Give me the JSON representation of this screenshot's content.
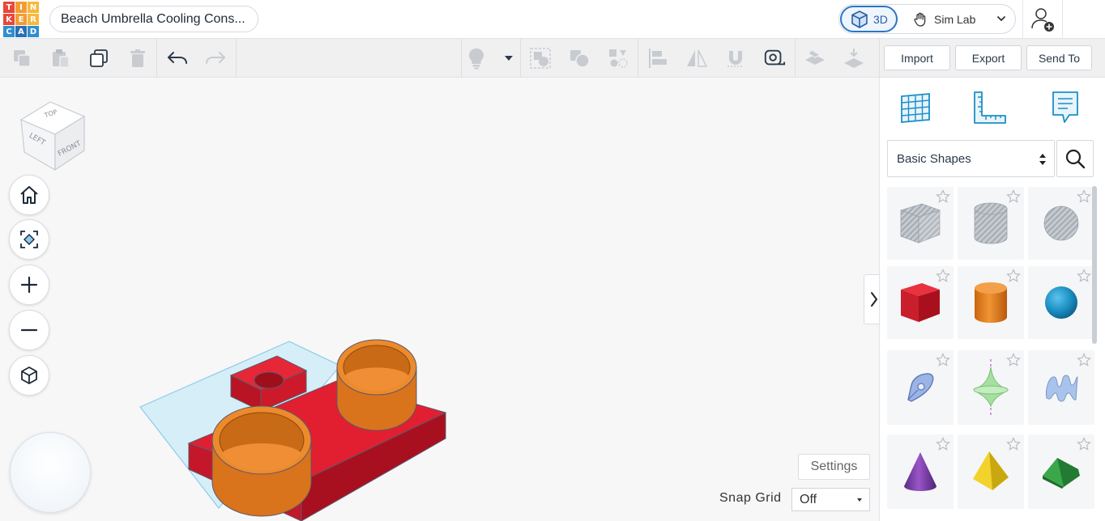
{
  "logo": {
    "letters": [
      "T",
      "I",
      "N",
      "K",
      "E",
      "R",
      "C",
      "A",
      "D"
    ],
    "colors": [
      "#e8473a",
      "#f39c32",
      "#f6b93b",
      "#e8473a",
      "#f39c32",
      "#f6b93b",
      "#2e8fd0",
      "#2a6fb4",
      "#2e8fd0"
    ]
  },
  "project": {
    "title": "Beach Umbrella Cooling Cons..."
  },
  "mode": {
    "active_label": "3D",
    "other_label": "Sim Lab"
  },
  "toolbar": {
    "import_label": "Import",
    "export_label": "Export",
    "send_to_label": "Send To"
  },
  "viewcube": {
    "top": "TOP",
    "left": "LEFT",
    "front": "FRONT"
  },
  "workplane": {
    "settings_label": "Settings",
    "snap_grid_label": "Snap Grid",
    "snap_grid_value": "Off"
  },
  "panel": {
    "category": "Basic Shapes",
    "shapes": [
      "box-hole",
      "cylinder-hole",
      "sphere-hole",
      "box",
      "cylinder",
      "sphere",
      "scribble",
      "shape-generator",
      "text",
      "cone",
      "pyramid",
      "roof"
    ]
  },
  "colors": {
    "accent": "#2a76c9",
    "red": "#d81e2c",
    "orange": "#e67e22",
    "plane": "#bfe3f3"
  }
}
